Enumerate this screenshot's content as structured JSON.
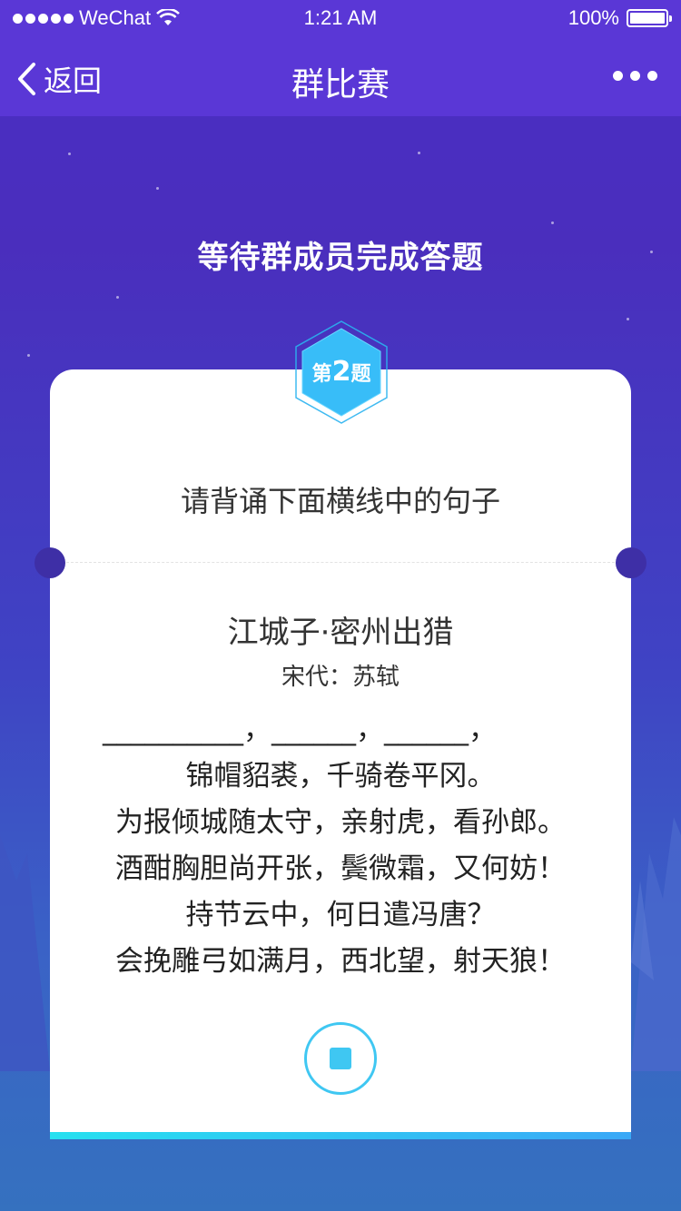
{
  "status_bar": {
    "carrier": "WeChat",
    "time": "1:21 AM",
    "battery": "100%",
    "battery_level": 1.0
  },
  "nav": {
    "back_label": "返回",
    "title": "群比赛",
    "more_icon": "more-dots-icon"
  },
  "headline": "等待群成员完成答题",
  "question_badge": {
    "prefix": "第",
    "number": "2",
    "suffix": "题"
  },
  "card": {
    "question": "请背诵下面横线中的句子",
    "poem_title": "江城子·密州出猎",
    "poem_author": "宋代：苏轼",
    "lines": [
      "__________，______，______，",
      "锦帽貂裘，千骑卷平冈。",
      "为报倾城随太守，亲射虎，看孙郎。",
      "酒酣胸胆尚开张，鬓微霜，又何妨！",
      "持节云中，何日遣冯唐？",
      "会挽雕弓如满月，西北望，射天狼！"
    ],
    "stop_icon": "stop-icon"
  },
  "colors": {
    "nav_background": "#5a37d6",
    "accent": "#3fc7f2",
    "badge": "#38bdf8"
  }
}
